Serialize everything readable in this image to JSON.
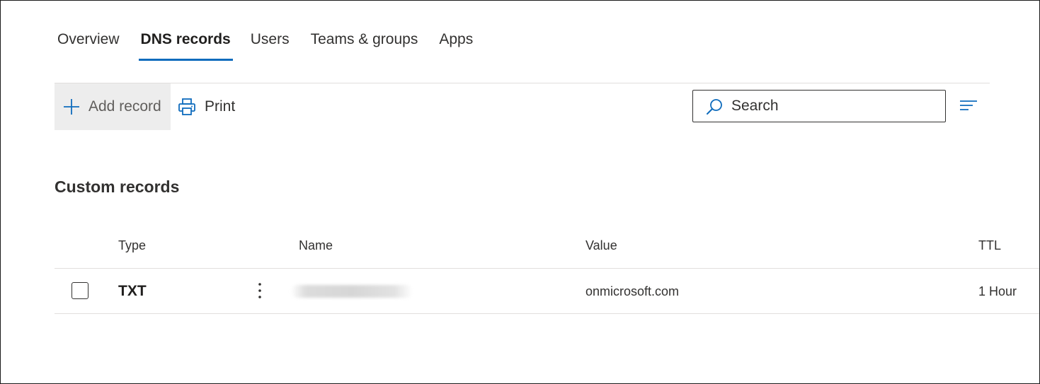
{
  "tabs": [
    {
      "label": "Overview"
    },
    {
      "label": "DNS records",
      "active": true
    },
    {
      "label": "Users"
    },
    {
      "label": "Teams & groups"
    },
    {
      "label": "Apps"
    }
  ],
  "toolbar": {
    "add_record_label": "Add record",
    "print_label": "Print",
    "search_placeholder": "Search"
  },
  "section": {
    "title": "Custom records"
  },
  "table": {
    "columns": [
      "Type",
      "Name",
      "Value",
      "TTL"
    ],
    "rows": [
      {
        "type": "TXT",
        "name": "",
        "value": "onmicrosoft.com",
        "ttl": "1 Hour"
      }
    ]
  },
  "colors": {
    "accent": "#0f6cbd",
    "text": "#323130",
    "divider": "#e1dfdd",
    "button_bg": "#ededed"
  },
  "icons": {
    "add": "plus-icon",
    "print": "printer-icon",
    "search": "search-icon",
    "filter": "filter-icon",
    "row_actions": "more-vertical-icon"
  }
}
